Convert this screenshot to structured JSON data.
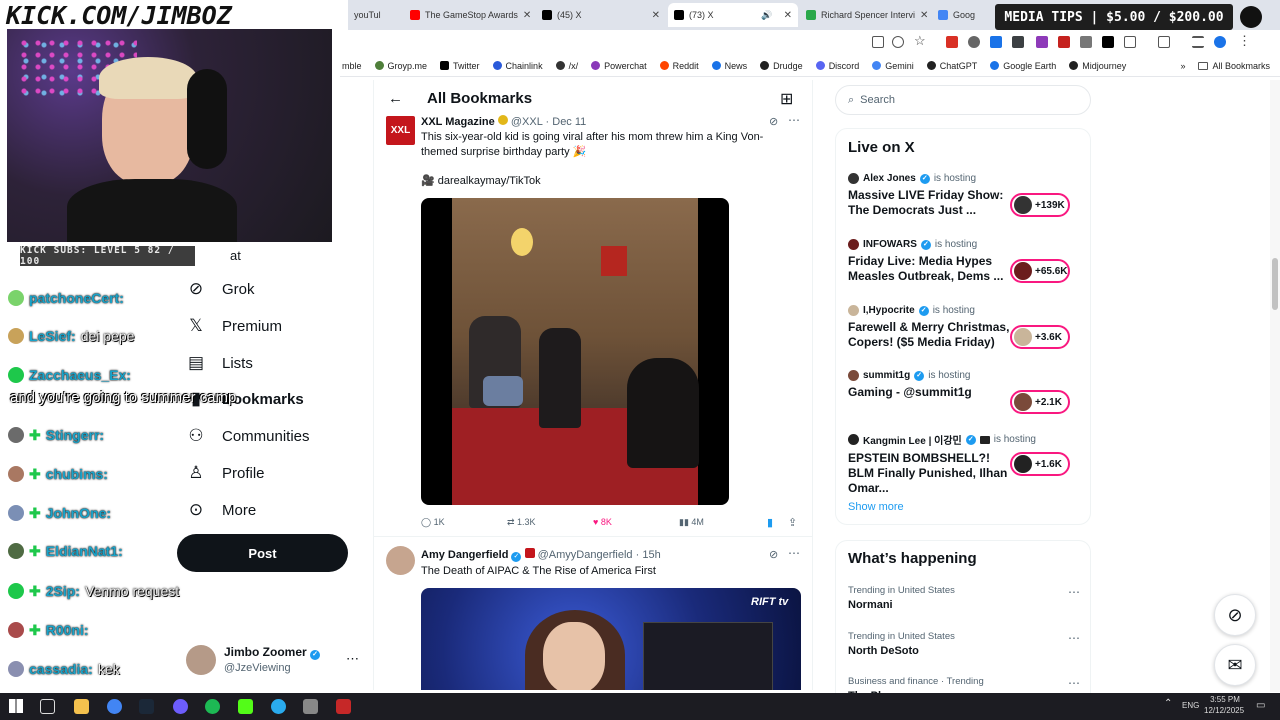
{
  "overlay": {
    "banner": "KICK.COM/JIMBOZ",
    "subs": "KICK SUBS: LEVEL 5 82 / 100",
    "media_tips": "MEDIA TIPS | $5.00 / $200.00",
    "caption": "and you're going to summer camp",
    "chat": [
      {
        "user": "patchoneCert:",
        "msg": "",
        "color": "#7ad36b"
      },
      {
        "user": "LeSief:",
        "msg": "dei pepe",
        "color": "#c8a25a"
      },
      {
        "user": "Zacchaeus_Ex:",
        "msg": "",
        "color": "#1ec84b"
      },
      {
        "user": "Stingerr:",
        "msg": "",
        "color": "#6b6b6b"
      },
      {
        "user": "chubims:",
        "msg": "",
        "color": "#a97862"
      },
      {
        "user": "JohnOne:",
        "msg": "",
        "color": "#7b8fb5"
      },
      {
        "user": "EldianNat1:",
        "msg": "",
        "color": "#4f6b43"
      },
      {
        "user": "2Sip:",
        "msg": "Venmo request",
        "color": "#1ec84b"
      },
      {
        "user": "R00ni:",
        "msg": "",
        "color": "#a94b4b"
      },
      {
        "user": "cassadia:",
        "msg": "kek",
        "color": "#8a8fb0"
      }
    ]
  },
  "browser": {
    "tabs": [
      {
        "label": "youTul",
        "color": "#ff0000"
      },
      {
        "label": "The GameStop Awards",
        "color": "#ff0000"
      },
      {
        "label": "(45) X",
        "color": "#000000"
      },
      {
        "label": "(73) X",
        "color": "#000000"
      },
      {
        "label": "Richard Spencer Intervi",
        "color": "#2aa84a"
      },
      {
        "label": "Goog",
        "color": "#4285f4"
      }
    ],
    "bookmarks": [
      {
        "label": "mble",
        "color": "#999999"
      },
      {
        "label": "Groyp.me",
        "color": "#4f7f3a"
      },
      {
        "label": "Twitter",
        "color": "#000000"
      },
      {
        "label": "Chainlink",
        "color": "#2a5ada"
      },
      {
        "label": "/x/",
        "color": "#333333"
      },
      {
        "label": "Powerchat",
        "color": "#8a3ab9"
      },
      {
        "label": "Reddit",
        "color": "#ff4500"
      },
      {
        "label": "News",
        "color": "#1a73e8"
      },
      {
        "label": "Drudge",
        "color": "#222222"
      },
      {
        "label": "Discord",
        "color": "#5865f2"
      },
      {
        "label": "Gemini",
        "color": "#4285f4"
      },
      {
        "label": "ChatGPT",
        "color": "#222222"
      },
      {
        "label": "Google Earth",
        "color": "#1a73e8"
      },
      {
        "label": "Midjourney",
        "color": "#222222"
      }
    ],
    "all_bookmarks": "All Bookmarks"
  },
  "nav": {
    "partial": "at",
    "items": [
      {
        "label": "Grok",
        "icon": "grok-icon",
        "glyph": "⊘"
      },
      {
        "label": "Premium",
        "icon": "x-logo-icon",
        "glyph": "𝕏"
      },
      {
        "label": "Lists",
        "icon": "lists-icon",
        "glyph": "☰"
      },
      {
        "label": "Bookmarks",
        "icon": "bookmark-icon",
        "glyph": "🔖"
      },
      {
        "label": "Communities",
        "icon": "communities-icon",
        "glyph": "👥"
      },
      {
        "label": "Profile",
        "icon": "profile-icon",
        "glyph": "👤"
      },
      {
        "label": "More",
        "icon": "more-icon",
        "glyph": "⋯"
      }
    ],
    "post": "Post",
    "profile_name": "Jimbo Zoomer",
    "profile_handle": "@JzeViewing"
  },
  "main": {
    "title": "All Bookmarks",
    "tweet1": {
      "name": "XXL Magazine",
      "handle": "@XXL",
      "date": "Dec 11",
      "text": "This six-year-old kid is going viral after his mom threw him a King Von-themed surprise birthday party 🎉",
      "credit": "🎥 darealkaymay/TikTok",
      "replies": "1K",
      "reposts": "1.3K",
      "likes": "8K",
      "views": "4M"
    },
    "tweet2": {
      "name": "Amy Dangerfield",
      "handle": "@AmyyDangerfield",
      "date": "15h",
      "text": "The Death of AIPAC & The Rise of America First",
      "video_logo": "RIFT tv"
    }
  },
  "right": {
    "search_placeholder": "Search",
    "live_title": "Live on X",
    "hosting": "is hosting",
    "live": [
      {
        "host": "Alex Jones",
        "title": "Massive LIVE Friday Show: The Democrats Just ...",
        "count": "+139K",
        "color": "#333333"
      },
      {
        "host": "INFOWARS",
        "title": "Friday Live: Media Hypes Measles Outbreak, Dems ...",
        "count": "+65.6K",
        "color": "#6b1d1d"
      },
      {
        "host": "I,Hypocrite",
        "title": "Farewell & Merry Christmas, Copers! ($5 Media Friday)",
        "count": "+3.6K",
        "color": "#c9b59a"
      },
      {
        "host": "summit1g",
        "title": "Gaming - @summit1g",
        "count": "+2.1K",
        "color": "#7a4a3a"
      },
      {
        "host": "Kangmin Lee | 이강민",
        "title": "EPSTEIN BOMBSHELL?! BLM Finally Punished, Ilhan Omar...",
        "count": "+1.6K",
        "color": "#222222"
      }
    ],
    "show_more": "Show more",
    "happening_title": "What’s happening",
    "trends": [
      {
        "context": "Trending in United States",
        "name": "Normani"
      },
      {
        "context": "Trending in United States",
        "name": "North DeSoto"
      },
      {
        "context": "Business and finance · Trending",
        "name": "The Plaques"
      }
    ]
  },
  "taskbar": {
    "lang": "ENG",
    "time": "3:55 PM",
    "date": "12/12/2025"
  }
}
